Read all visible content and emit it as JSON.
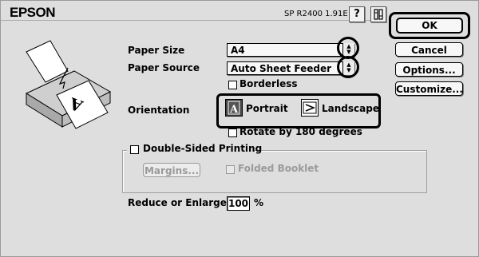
{
  "header": {
    "brand": "EPSON",
    "model": "SP R2400 1.91E",
    "help_label": "?"
  },
  "paper_size": {
    "label": "Paper Size",
    "value": "A4"
  },
  "paper_source": {
    "label": "Paper Source",
    "value": "Auto Sheet Feeder"
  },
  "borderless": {
    "label": "Borderless",
    "checked": false
  },
  "orientation": {
    "label": "Orientation",
    "portrait_label": "Portrait",
    "landscape_label": "Landscape",
    "selected": "Portrait"
  },
  "rotate": {
    "label": "Rotate by 180 degrees",
    "checked": false
  },
  "double_sided": {
    "label": "Double-Sided Printing",
    "checked": false,
    "margins_label": "Margins...",
    "folded_label": "Folded Booklet"
  },
  "reduce": {
    "label": "Reduce or Enlarge",
    "value": "100",
    "unit": "%"
  },
  "buttons": {
    "ok": "OK",
    "cancel": "Cancel",
    "options": "Options...",
    "customize": "Customize..."
  },
  "icons": [
    "help-icon",
    "config-icon",
    "printer-illustration",
    "popup-arrows-icon",
    "portrait-icon",
    "landscape-icon"
  ]
}
